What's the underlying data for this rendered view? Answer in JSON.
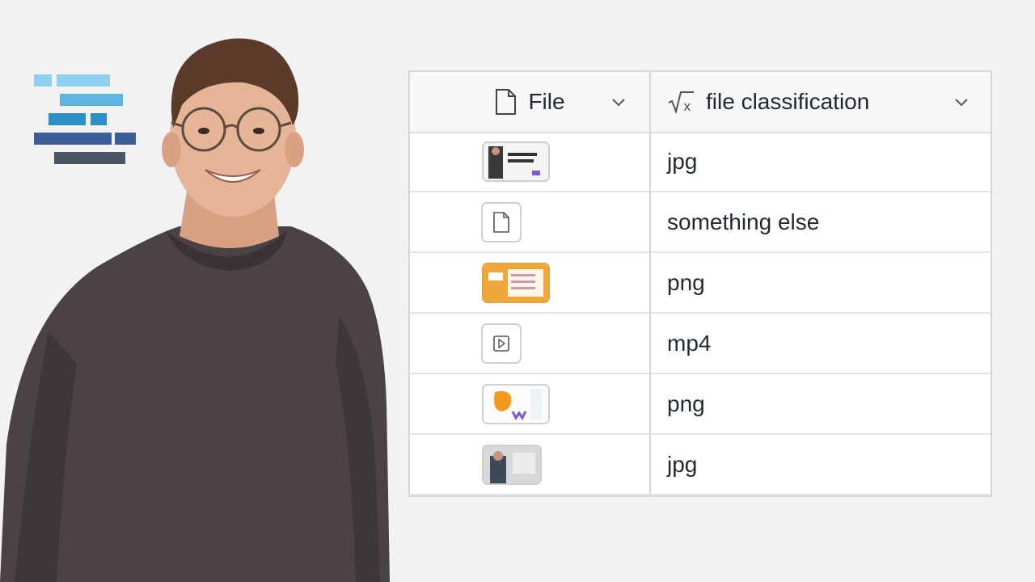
{
  "colors": {
    "background": "#f2f2f2",
    "logo_light": "#8fd0ef",
    "logo_mid": "#2f8fc4",
    "logo_dark": "#3b5f99",
    "logo_gray": "#4c5563"
  },
  "table": {
    "columns": [
      {
        "label": "File",
        "icon": "file-icon"
      },
      {
        "label": "file classification",
        "icon": "formula-icon"
      }
    ],
    "rows": [
      {
        "thumb": "image-thumbnail",
        "classification": "jpg"
      },
      {
        "thumb": "file-icon",
        "classification": "something else"
      },
      {
        "thumb": "image-thumbnail",
        "classification": "png"
      },
      {
        "thumb": "video-file-icon",
        "classification": "mp4"
      },
      {
        "thumb": "image-thumbnail",
        "classification": "png"
      },
      {
        "thumb": "image-thumbnail",
        "classification": "jpg"
      }
    ]
  }
}
